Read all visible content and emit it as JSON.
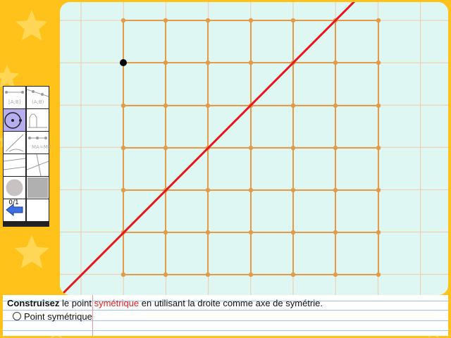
{
  "colors": {
    "background": "#ffc21a",
    "star": "#ffd656",
    "canvas": "#def7f3",
    "grid_line": "#f2c9a7",
    "lattice": "#e39b48",
    "symmetry_axis": "#e8161a",
    "point": "#000000",
    "highlight_text": "#e02020"
  },
  "toolbar": {
    "tools": [
      {
        "name": "segment-tool-icon",
        "label": "[A;B]"
      },
      {
        "name": "line-tool-icon",
        "label": "(A;B)"
      },
      {
        "name": "point-tool-icon",
        "label": "",
        "selected": true
      },
      {
        "name": "draw-tool-icon",
        "label": ""
      },
      {
        "name": "compass-tool-icon",
        "label": ""
      },
      {
        "name": "equal-length-tool-icon",
        "label": "MA=MB"
      },
      {
        "name": "parallel-tool-icon",
        "label": ""
      },
      {
        "name": "perpendicular-tool-icon",
        "label": ""
      },
      {
        "name": "gray-circle-icon",
        "label": ""
      },
      {
        "name": "gray-square-icon",
        "label": ""
      },
      {
        "name": "undo-arrow-icon",
        "label": ""
      },
      {
        "name": "empty-tool",
        "label": ""
      }
    ],
    "counter": "0/1"
  },
  "instruction": {
    "bold": "Construisez",
    "part1": " le point ",
    "keyword": "symétrique",
    "part2": " en utilisant la droite comme axe de symétrie.",
    "task": "Point symétrique"
  }
}
